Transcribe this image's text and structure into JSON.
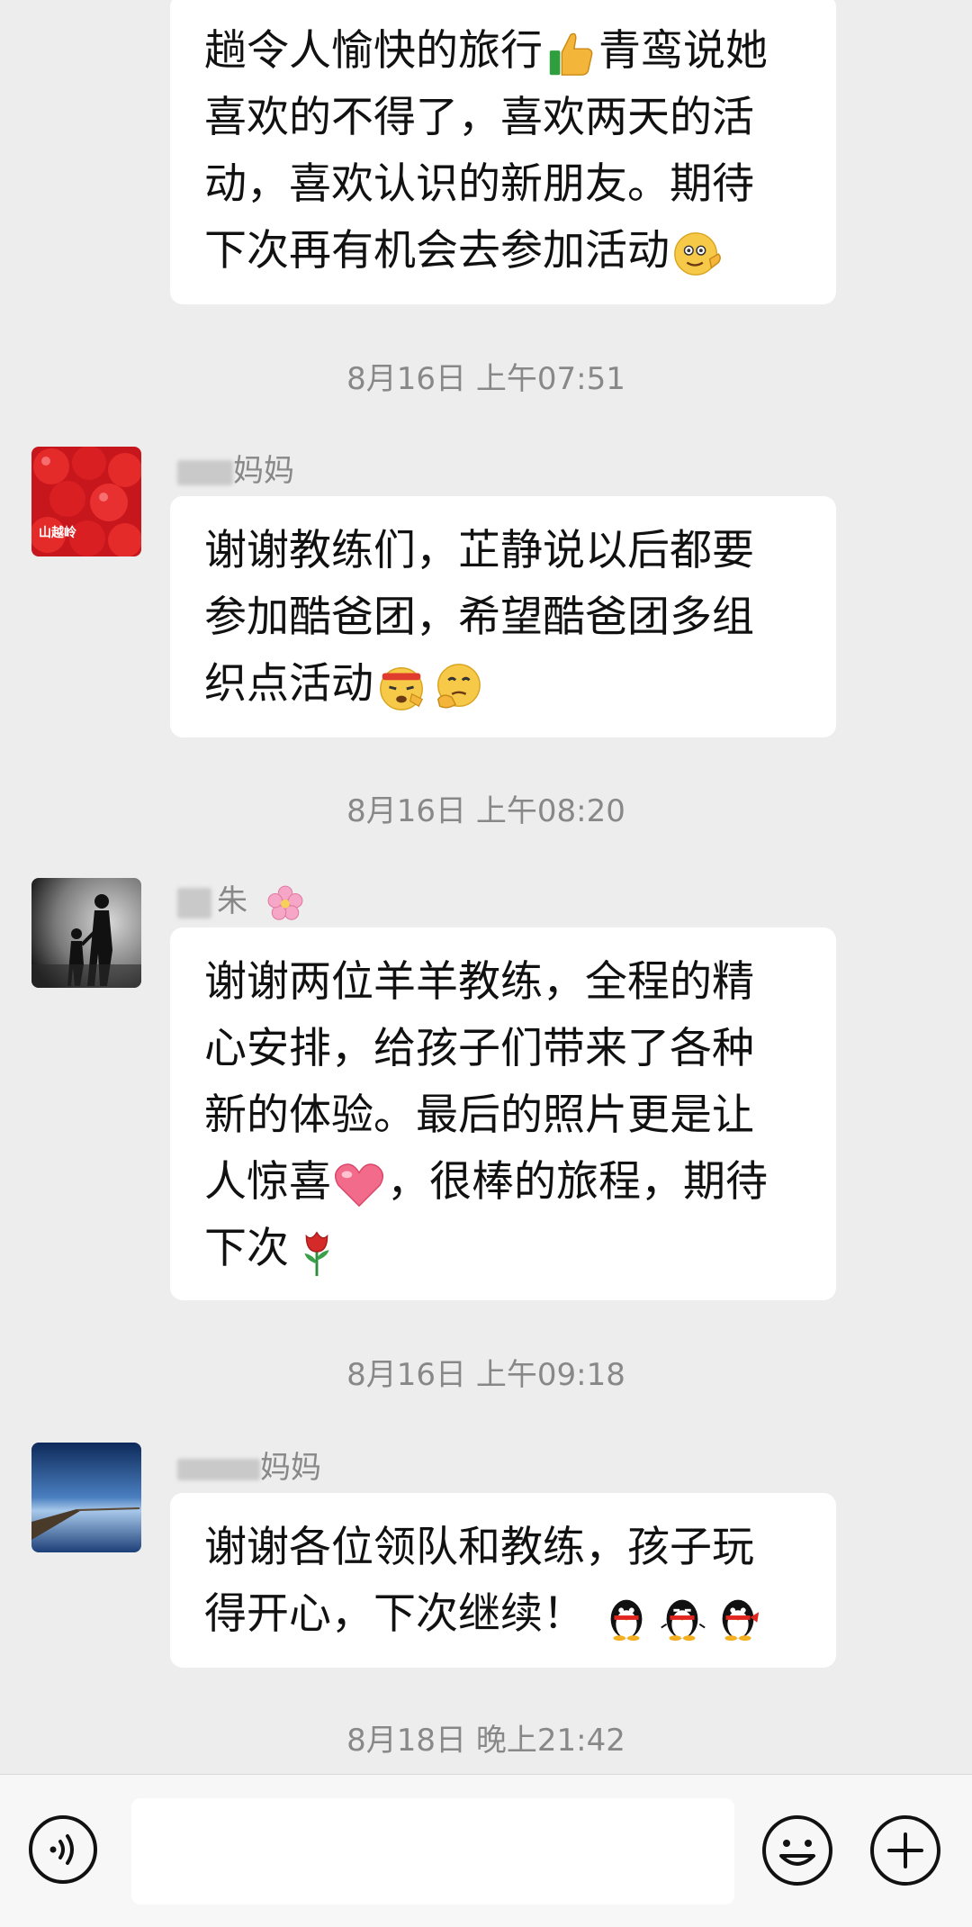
{
  "messages": [
    {
      "lines": [
        "趟令人愉快的旅行",
        "喜欢的不得了，喜欢两天的活",
        "动，喜欢认识的新朋友。期待",
        "下次再有机会去参加活动"
      ],
      "line1_tail": "青鸾说她",
      "emoji": [
        "thumbs-up",
        "winking-face"
      ]
    },
    {
      "timestamp": "8月16日 上午07:51",
      "sender_visible": "妈妈",
      "avatar": "tomato-avatar",
      "avatar_text": "山越岭",
      "lines": [
        "谢谢教练们，芷静说以后都要",
        "参加酷爸团，希望酷爸团多组",
        "织点活动"
      ],
      "emoji": [
        "salute-face",
        "thinking-face"
      ]
    },
    {
      "timestamp": "8月16日 上午08:20",
      "sender_visible": "朱",
      "avatar": "silhouette-avatar",
      "lines": [
        "谢谢两位羊羊教练，全程的精",
        "心安排，给孩子们带来了各种",
        "新的体验。最后的照片更是让",
        "人惊喜",
        "下次"
      ],
      "line4_tail": "，很棒的旅程，期待",
      "emoji": [
        "heart",
        "rose",
        "cherry-blossom"
      ]
    },
    {
      "timestamp": "8月16日 上午09:18",
      "sender_visible": "妈妈",
      "avatar": "pier-avatar",
      "lines": [
        "谢谢各位领队和教练，孩子玩",
        "得开心，下次继续！"
      ],
      "emoji": [
        "penguin",
        "penguin",
        "penguin"
      ]
    }
  ],
  "last_timestamp": "8月18日 晚上21:42",
  "input_bar": {
    "placeholder": "",
    "icons": [
      "voice-icon",
      "emoji-icon",
      "plus-icon"
    ]
  }
}
